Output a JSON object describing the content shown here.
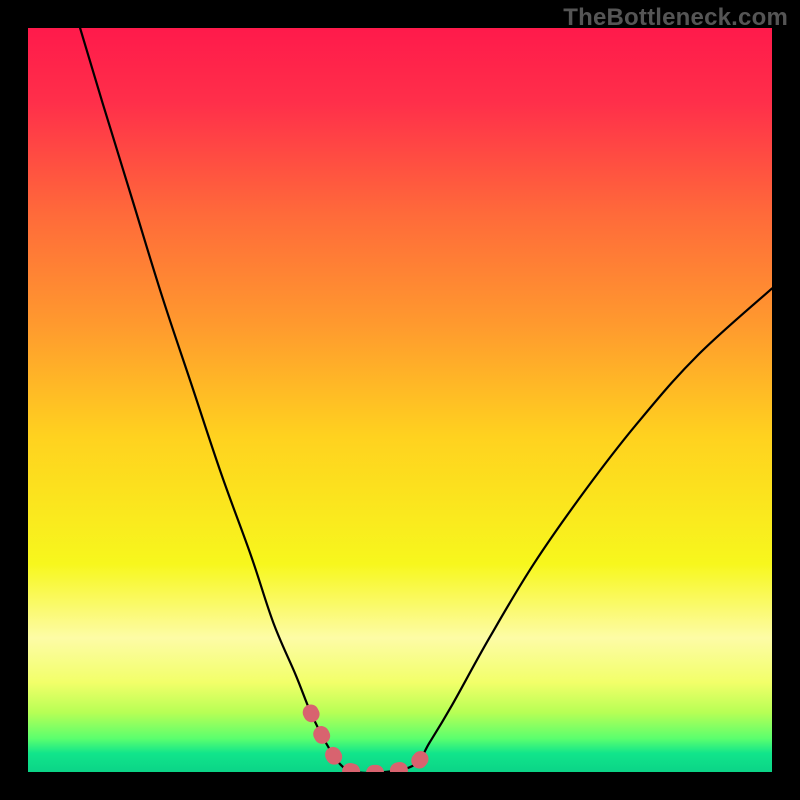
{
  "watermark": "TheBottleneck.com",
  "chart_data": {
    "type": "line",
    "title": "",
    "xlabel": "",
    "ylabel": "",
    "xlim": [
      0,
      100
    ],
    "ylim": [
      0,
      100
    ],
    "grid": false,
    "legend": false,
    "series": [
      {
        "name": "curve",
        "color": "#000000",
        "x": [
          7,
          10,
          14,
          18,
          22,
          26,
          30,
          33,
          36,
          38,
          40,
          42,
          44,
          48,
          52,
          54,
          57,
          62,
          68,
          75,
          82,
          90,
          100
        ],
        "y": [
          100,
          90,
          77,
          64,
          52,
          40,
          29,
          20,
          13,
          8,
          4,
          1,
          0,
          0,
          1,
          4,
          9,
          18,
          28,
          38,
          47,
          56,
          65
        ]
      },
      {
        "name": "highlight",
        "color": "#d8636f",
        "x": [
          38,
          40,
          42,
          44,
          48,
          52,
          54
        ],
        "y": [
          8,
          4,
          1,
          0,
          0,
          1,
          4
        ]
      }
    ],
    "background_gradient": {
      "type": "vertical",
      "stops": [
        {
          "offset": 0.0,
          "color": "#ff1a4b"
        },
        {
          "offset": 0.1,
          "color": "#ff2f4a"
        },
        {
          "offset": 0.25,
          "color": "#ff6a3a"
        },
        {
          "offset": 0.4,
          "color": "#ff9a2e"
        },
        {
          "offset": 0.55,
          "color": "#ffd21f"
        },
        {
          "offset": 0.72,
          "color": "#f7f71d"
        },
        {
          "offset": 0.82,
          "color": "#fdfca6"
        },
        {
          "offset": 0.88,
          "color": "#f2ff69"
        },
        {
          "offset": 0.92,
          "color": "#b7ff55"
        },
        {
          "offset": 0.955,
          "color": "#5bff6e"
        },
        {
          "offset": 0.975,
          "color": "#11e58b"
        },
        {
          "offset": 1.0,
          "color": "#0bd487"
        }
      ]
    }
  }
}
